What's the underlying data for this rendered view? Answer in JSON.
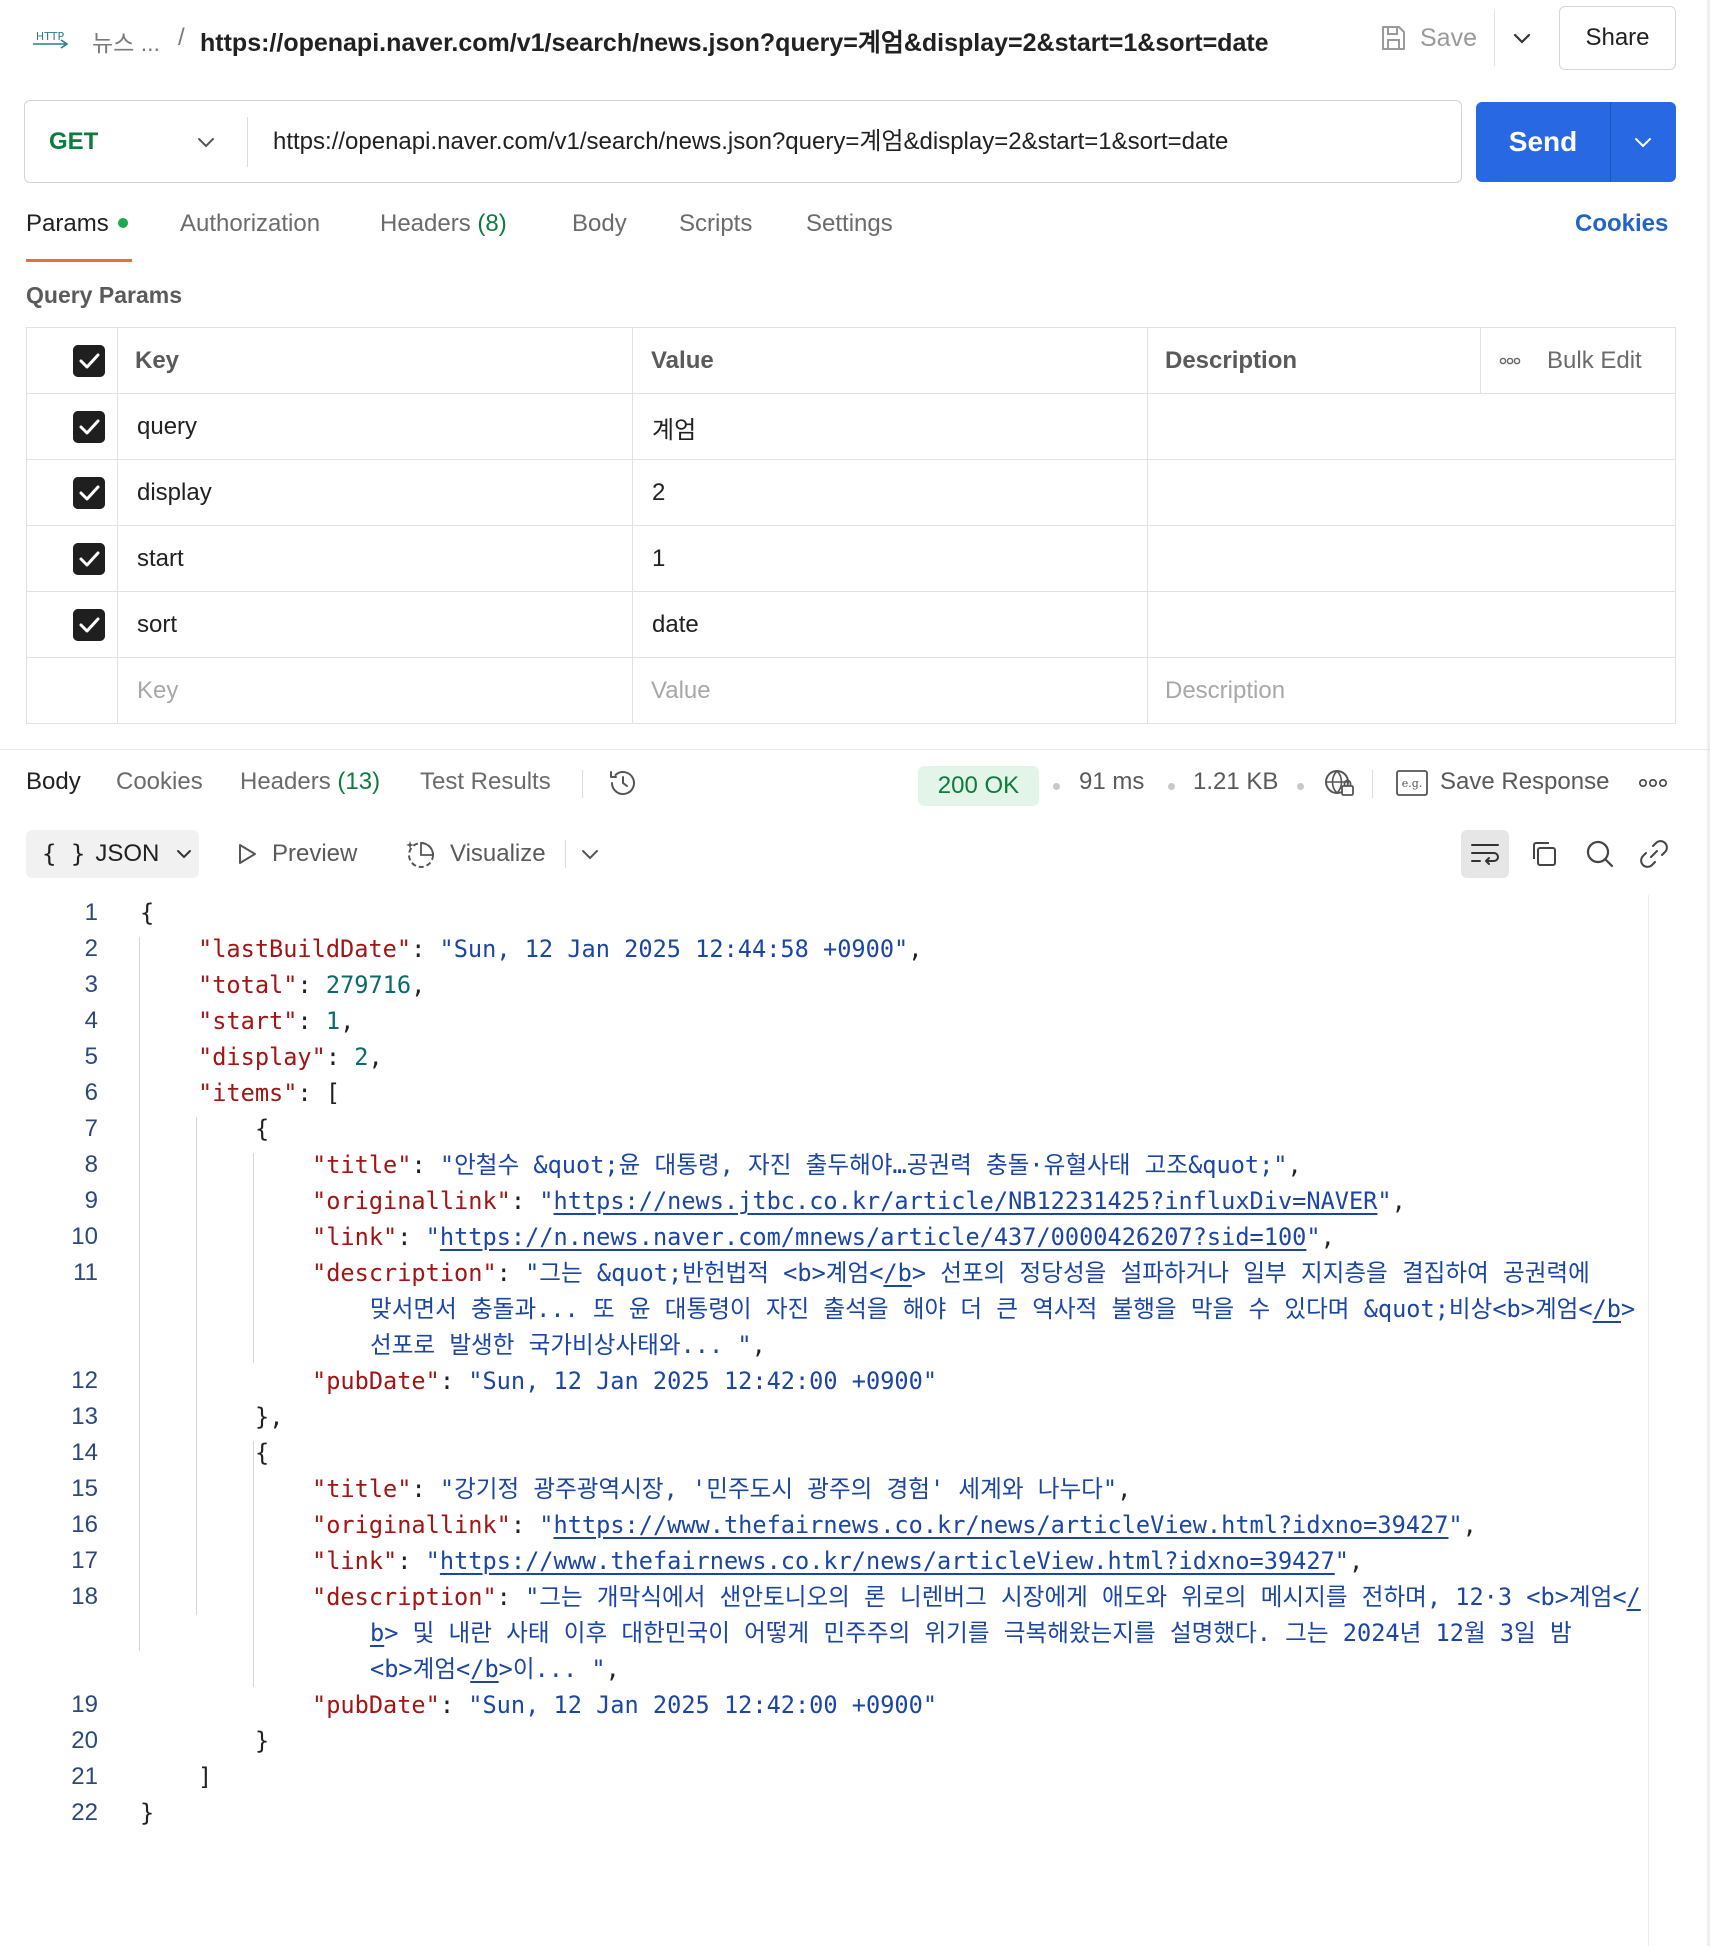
{
  "header": {
    "breadcrumb_short": "뉴스 ...",
    "breadcrumb_sep": "/",
    "request_name": "https://openapi.naver.com/v1/search/news.json?query=계엄&display=2&start=1&sort=date",
    "save_label": "Save",
    "share_label": "Share",
    "http_badge": "HTTP"
  },
  "request": {
    "method": "GET",
    "url": "https://openapi.naver.com/v1/search/news.json?query=계엄&display=2&start=1&sort=date",
    "send_label": "Send"
  },
  "request_tabs": {
    "params": "Params",
    "authorization": "Authorization",
    "headers": "Headers",
    "headers_count": "(8)",
    "body": "Body",
    "scripts": "Scripts",
    "settings": "Settings",
    "cookies": "Cookies"
  },
  "query_params": {
    "title": "Query Params",
    "columns": {
      "key": "Key",
      "value": "Value",
      "description": "Description"
    },
    "bulk_edit": "Bulk Edit",
    "rows": [
      {
        "key": "query",
        "value": "계엄",
        "checked": true
      },
      {
        "key": "display",
        "value": "2",
        "checked": true
      },
      {
        "key": "start",
        "value": "1",
        "checked": true
      },
      {
        "key": "sort",
        "value": "date",
        "checked": true
      }
    ],
    "placeholders": {
      "key": "Key",
      "value": "Value",
      "description": "Description"
    }
  },
  "response_tabs": {
    "body": "Body",
    "cookies": "Cookies",
    "headers": "Headers",
    "headers_count": "(13)",
    "test_results": "Test Results",
    "status": "200 OK",
    "time": "91 ms",
    "size": "1.21 KB",
    "save_response": "Save Response",
    "eg_label": "e.g."
  },
  "body_toolbar": {
    "format": "JSON",
    "preview": "Preview",
    "visualize": "Visualize"
  },
  "response_body": {
    "lines": [
      {
        "n": "1",
        "indent": 0,
        "parts": [
          {
            "t": "{",
            "c": "p"
          }
        ]
      },
      {
        "n": "2",
        "indent": 1,
        "parts": [
          {
            "t": "\"lastBuildDate\"",
            "c": "k"
          },
          {
            "t": ": ",
            "c": "p"
          },
          {
            "t": "\"Sun, 12 Jan 2025 12:44:58 +0900\"",
            "c": "s"
          },
          {
            "t": ",",
            "c": "p"
          }
        ]
      },
      {
        "n": "3",
        "indent": 1,
        "parts": [
          {
            "t": "\"total\"",
            "c": "k"
          },
          {
            "t": ": ",
            "c": "p"
          },
          {
            "t": "279716",
            "c": "n"
          },
          {
            "t": ",",
            "c": "p"
          }
        ]
      },
      {
        "n": "4",
        "indent": 1,
        "parts": [
          {
            "t": "\"start\"",
            "c": "k"
          },
          {
            "t": ": ",
            "c": "p"
          },
          {
            "t": "1",
            "c": "n"
          },
          {
            "t": ",",
            "c": "p"
          }
        ]
      },
      {
        "n": "5",
        "indent": 1,
        "parts": [
          {
            "t": "\"display\"",
            "c": "k"
          },
          {
            "t": ": ",
            "c": "p"
          },
          {
            "t": "2",
            "c": "n"
          },
          {
            "t": ",",
            "c": "p"
          }
        ]
      },
      {
        "n": "6",
        "indent": 1,
        "parts": [
          {
            "t": "\"items\"",
            "c": "k"
          },
          {
            "t": ": [",
            "c": "p"
          }
        ]
      },
      {
        "n": "7",
        "indent": 2,
        "parts": [
          {
            "t": "{",
            "c": "p"
          }
        ]
      },
      {
        "n": "8",
        "indent": 3,
        "parts": [
          {
            "t": "\"title\"",
            "c": "k"
          },
          {
            "t": ": ",
            "c": "p"
          },
          {
            "t": "\"안철수 &quot;윤 대통령, 자진 출두해야…공권력 충돌·유혈사태 고조&quot;\"",
            "c": "s"
          },
          {
            "t": ",",
            "c": "p"
          }
        ]
      },
      {
        "n": "9",
        "indent": 3,
        "parts": [
          {
            "t": "\"originallink\"",
            "c": "k"
          },
          {
            "t": ": ",
            "c": "p"
          },
          {
            "t": "\"",
            "c": "s"
          },
          {
            "t": "https://news.jtbc.co.kr/article/NB12231425?influxDiv=NAVER",
            "c": "su"
          },
          {
            "t": "\"",
            "c": "s"
          },
          {
            "t": ",",
            "c": "p"
          }
        ]
      },
      {
        "n": "10",
        "indent": 3,
        "parts": [
          {
            "t": "\"link\"",
            "c": "k"
          },
          {
            "t": ": ",
            "c": "p"
          },
          {
            "t": "\"",
            "c": "s"
          },
          {
            "t": "https://n.news.naver.com/mnews/article/437/0000426207?sid=100",
            "c": "su"
          },
          {
            "t": "\"",
            "c": "s"
          },
          {
            "t": ",",
            "c": "p"
          }
        ]
      },
      {
        "n": "11",
        "indent": 3,
        "parts": [
          {
            "t": "\"description\"",
            "c": "k"
          },
          {
            "t": ": ",
            "c": "p"
          },
          {
            "t": "\"그는 &quot;반헌법적 <b>계엄<",
            "c": "s"
          },
          {
            "t": "/b",
            "c": "su"
          },
          {
            "t": "> 선포의 정당성을 설파하거나 일부 지지층을 결집하여 공권력에",
            "c": "s"
          }
        ]
      },
      {
        "n": "",
        "indent": 4,
        "parts": [
          {
            "t": "맞서면서 충돌과... 또 윤 대통령이 자진 출석을 해야 더 큰 역사적 불행을 막을 수 있다며 &quot;비상<b>계엄<",
            "c": "s"
          },
          {
            "t": "/b",
            "c": "su"
          },
          {
            "t": ">",
            "c": "s"
          }
        ]
      },
      {
        "n": "",
        "indent": 4,
        "parts": [
          {
            "t": "선포로 발생한 국가비상사태와... \"",
            "c": "s"
          },
          {
            "t": ",",
            "c": "p"
          }
        ]
      },
      {
        "n": "12",
        "indent": 3,
        "parts": [
          {
            "t": "\"pubDate\"",
            "c": "k"
          },
          {
            "t": ": ",
            "c": "p"
          },
          {
            "t": "\"Sun, 12 Jan 2025 12:42:00 +0900\"",
            "c": "s"
          }
        ]
      },
      {
        "n": "13",
        "indent": 2,
        "parts": [
          {
            "t": "},",
            "c": "p"
          }
        ]
      },
      {
        "n": "14",
        "indent": 2,
        "parts": [
          {
            "t": "{",
            "c": "p"
          }
        ]
      },
      {
        "n": "15",
        "indent": 3,
        "parts": [
          {
            "t": "\"title\"",
            "c": "k"
          },
          {
            "t": ": ",
            "c": "p"
          },
          {
            "t": "\"강기정 광주광역시장, '민주도시 광주의 경험' 세계와 나누다\"",
            "c": "s"
          },
          {
            "t": ",",
            "c": "p"
          }
        ]
      },
      {
        "n": "16",
        "indent": 3,
        "parts": [
          {
            "t": "\"originallink\"",
            "c": "k"
          },
          {
            "t": ": ",
            "c": "p"
          },
          {
            "t": "\"",
            "c": "s"
          },
          {
            "t": "https://www.thefairnews.co.kr/news/articleView.html?idxno=39427",
            "c": "su"
          },
          {
            "t": "\"",
            "c": "s"
          },
          {
            "t": ",",
            "c": "p"
          }
        ]
      },
      {
        "n": "17",
        "indent": 3,
        "parts": [
          {
            "t": "\"link\"",
            "c": "k"
          },
          {
            "t": ": ",
            "c": "p"
          },
          {
            "t": "\"",
            "c": "s"
          },
          {
            "t": "https://www.thefairnews.co.kr/news/articleView.html?idxno=39427",
            "c": "su"
          },
          {
            "t": "\"",
            "c": "s"
          },
          {
            "t": ",",
            "c": "p"
          }
        ]
      },
      {
        "n": "18",
        "indent": 3,
        "parts": [
          {
            "t": "\"description\"",
            "c": "k"
          },
          {
            "t": ": ",
            "c": "p"
          },
          {
            "t": "\"그는 개막식에서 샌안토니오의 론 니렌버그 시장에게 애도와 위로의 메시지를 전하며, 12·3 <b>계엄<",
            "c": "s"
          },
          {
            "t": "/",
            "c": "su"
          }
        ]
      },
      {
        "n": "",
        "indent": 4,
        "parts": [
          {
            "t": "b",
            "c": "su"
          },
          {
            "t": "> 및 내란 사태 이후 대한민국이 어떻게 민주주의 위기를 극복해왔는지를 설명했다. 그는 2024년 12월 3일 밤",
            "c": "s"
          }
        ]
      },
      {
        "n": "",
        "indent": 4,
        "parts": [
          {
            "t": "<b>계엄<",
            "c": "s"
          },
          {
            "t": "/b",
            "c": "su"
          },
          {
            "t": ">이... \"",
            "c": "s"
          },
          {
            "t": ",",
            "c": "p"
          }
        ]
      },
      {
        "n": "19",
        "indent": 3,
        "parts": [
          {
            "t": "\"pubDate\"",
            "c": "k"
          },
          {
            "t": ": ",
            "c": "p"
          },
          {
            "t": "\"Sun, 12 Jan 2025 12:42:00 +0900\"",
            "c": "s"
          }
        ]
      },
      {
        "n": "20",
        "indent": 2,
        "parts": [
          {
            "t": "}",
            "c": "p"
          }
        ]
      },
      {
        "n": "21",
        "indent": 1,
        "parts": [
          {
            "t": "]",
            "c": "p"
          }
        ]
      },
      {
        "n": "22",
        "indent": 0,
        "parts": [
          {
            "t": "}",
            "c": "p"
          }
        ]
      }
    ]
  },
  "colors": {
    "accent_orange": "#f26b3a",
    "send_blue": "#2869e3",
    "get_green": "#0f7b3d",
    "json_key": "#a31515",
    "json_string": "#1b46a3",
    "json_number": "#0b6b6b"
  }
}
